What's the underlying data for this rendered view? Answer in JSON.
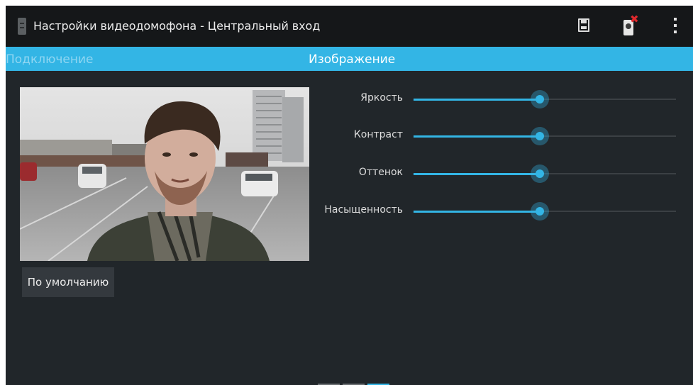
{
  "actionbar": {
    "title": "Настройки видеодомофона - Центральный вход",
    "icons": [
      "app-icon",
      "save-icon",
      "device-icon",
      "overflow-menu-icon"
    ]
  },
  "tabs": {
    "left": "Подключение",
    "current": "Изображение"
  },
  "preview": {
    "icon": "camera-preview"
  },
  "buttons": {
    "default": "По умолчанию"
  },
  "sliders": [
    {
      "label": "Яркость",
      "value": 0.48
    },
    {
      "label": "Контраст",
      "value": 0.48
    },
    {
      "label": "Оттенок",
      "value": 0.48
    },
    {
      "label": "Насыщенность",
      "value": 0.48
    }
  ],
  "pager": {
    "pages": 3,
    "current": 3
  },
  "colors": {
    "accent": "#33b5e5",
    "background": "#21262a",
    "actionbar": "#151719"
  }
}
